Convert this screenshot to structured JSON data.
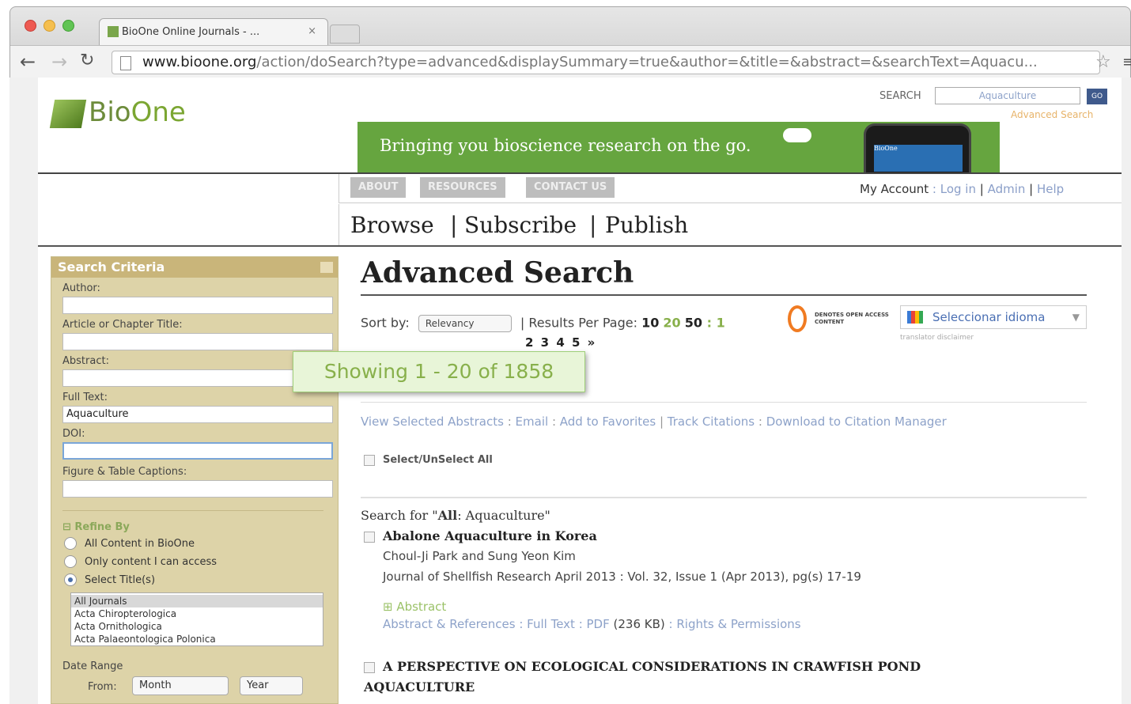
{
  "browser": {
    "tab_title": "BioOne Online Journals - ...",
    "tab_close": "×",
    "url_host": "www.bioone.org",
    "url_path": "/action/doSearch?type=advanced&displaySummary=true&author=&title=&abstract=&searchText=Aquacu..."
  },
  "header": {
    "logo_bio": "Bio",
    "logo_one": "One",
    "search_label": "SEARCH",
    "search_value": "Aquaculture",
    "go_label": "GO",
    "advanced_link": "Advanced Search",
    "banner_text": "Bringing you bioscience research on the go.",
    "phone_screen_text": "BioOne"
  },
  "nav": {
    "pills": [
      "ABOUT",
      "RESOURCES",
      "CONTACT US"
    ],
    "my_account": "My Account",
    "account_sep": " : ",
    "login": "Log in",
    "admin": "Admin",
    "help": "Help",
    "browse": "Browse",
    "subscribe": "Subscribe",
    "publish": "Publish"
  },
  "sidebar": {
    "title": "Search Criteria",
    "author_label": "Author:",
    "author_value": "",
    "title_label": "Article or Chapter Title:",
    "title_value": "",
    "abstract_label": "Abstract:",
    "abstract_value": "",
    "fulltext_label": "Full Text:",
    "fulltext_value": "Aquaculture",
    "doi_label": "DOI:",
    "doi_value": "",
    "captions_label": "Figure & Table Captions:",
    "captions_value": "",
    "refine_label": "⊟ Refine By",
    "radios": [
      {
        "label": "All Content in BioOne",
        "checked": false
      },
      {
        "label": "Only content I can access",
        "checked": false
      },
      {
        "label": "Select Title(s)",
        "checked": true
      }
    ],
    "journals": [
      "All Journals",
      "Acta Chiropterologica",
      "Acta Ornithologica",
      "Acta Palaeontologica Polonica"
    ],
    "date_range_label": "Date Range",
    "from_label": "From:",
    "month_select": "Month",
    "year_select": "Year"
  },
  "main": {
    "title": "Advanced Search",
    "sort_label": "Sort by:",
    "sort_value": "Relevancy",
    "results_per_page_label": "| Results Per Page:",
    "rpp_10": "10",
    "rpp_20": "20",
    "rpp_50": "50",
    "page_sep": " : 1",
    "pages": "2 3 4 5 »",
    "oa_text": "DENOTES OPEN ACCESS CONTENT",
    "language_select": "Seleccionar idioma",
    "language_caret": "▼",
    "translator_disclaimer": "translator disclaimer",
    "showing": "Showing 1 - 20 of 1858",
    "actions": {
      "view_selected": "View Selected Abstracts",
      "email": "Email",
      "add_favorites": "Add to Favorites",
      "track_citations": "Track Citations",
      "download_citation": "Download to Citation Manager"
    },
    "select_all": "Select/UnSelect All",
    "search_for_prefix": "Search for \"",
    "search_for_field": "All",
    "search_for_term": ": Aquaculture\"",
    "results": [
      {
        "title": "Abalone Aquaculture in Korea",
        "authors": "Choul-Ji Park and Sung Yeon Kim",
        "citation": "Journal of Shellfish Research April 2013 : Vol. 32, Issue 1 (Apr 2013), pg(s) 17-19",
        "abstract_toggle": "⊞ Abstract",
        "link_abs_refs": "Abstract & References",
        "link_full_text": "Full Text",
        "link_pdf": "PDF",
        "pdf_size": "(236 KB)",
        "link_rights": "Rights & Permissions"
      },
      {
        "title": "A PERSPECTIVE ON ECOLOGICAL CONSIDERATIONS IN CRAWFISH POND AQUACULTURE"
      }
    ]
  }
}
